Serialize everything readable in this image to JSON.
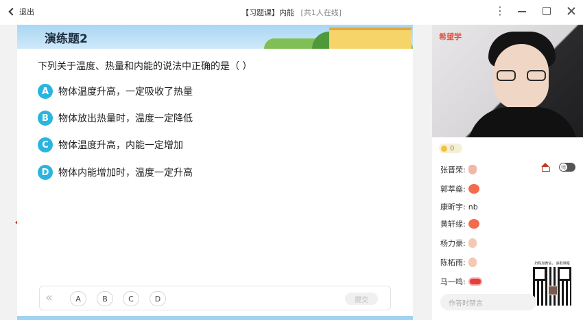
{
  "titlebar": {
    "back_label": "退出",
    "title_tag": "【习题课】",
    "title_name": "内能",
    "online": "[共1人在线]"
  },
  "lesson": {
    "banner_title": "演练题2",
    "question": "下列关于温度、热量和内能的说法中正确的是（    ）",
    "options": [
      {
        "letter": "A",
        "text": "物体温度升高，一定吸收了热量"
      },
      {
        "letter": "B",
        "text": "物体放出热量时，温度一定降低"
      },
      {
        "letter": "C",
        "text": "物体温度升高，内能一定增加"
      },
      {
        "letter": "D",
        "text": "物体内能增加时，温度一定升高"
      }
    ],
    "answer_choices": [
      "A",
      "B",
      "C",
      "D"
    ],
    "prev_symbol": "«",
    "submit_label": "提交"
  },
  "video": {
    "logo": "希望学"
  },
  "chat": {
    "coins": "0",
    "messages": [
      {
        "name": "张晋荣:",
        "text": "",
        "emoji": "thumb-icon"
      },
      {
        "name": "郭萃燊:",
        "text": "",
        "emoji": "face-icon"
      },
      {
        "name": "康昕宇:",
        "text": "nb",
        "emoji": ""
      },
      {
        "name": "黄轩缘:",
        "text": "",
        "emoji": "face-icon"
      },
      {
        "name": "杨力豪:",
        "text": "",
        "emoji": "ok-icon"
      },
      {
        "name": "陈柘雨:",
        "text": "",
        "emoji": "ok-icon"
      },
      {
        "name": "马一鸣:",
        "text": "",
        "emoji": "mouth-icon"
      }
    ],
    "toggle_label": "师",
    "qr_caption": "扫码加微信， 获取课程",
    "input_placeholder": "作答时禁言"
  },
  "colors": {
    "accent": "#2bb5de",
    "brand_red": "#e0533f"
  }
}
